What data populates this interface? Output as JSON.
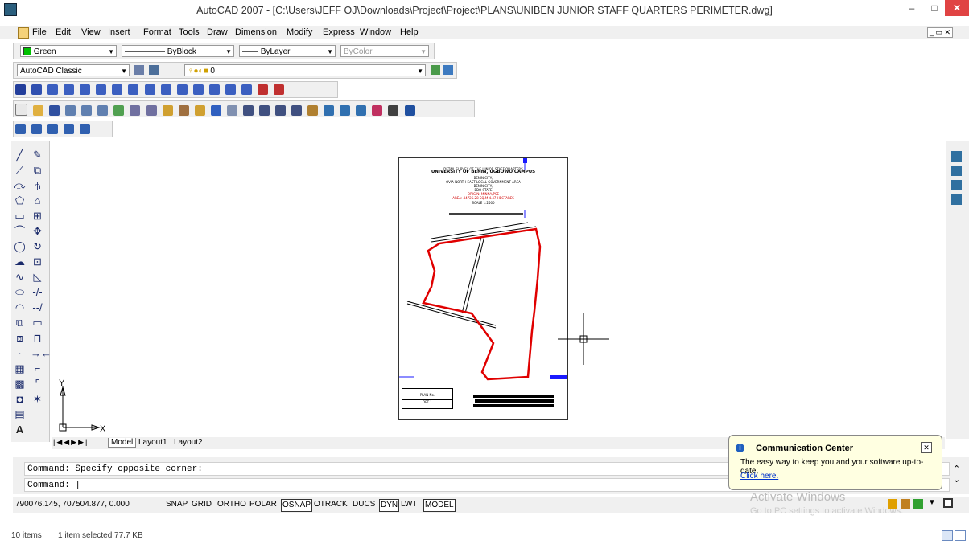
{
  "window": {
    "title": "AutoCAD 2007 - [C:\\Users\\JEFF OJ\\Downloads\\Project\\Project\\PLANS\\UNIBEN JUNIOR STAFF QUARTERS  PERIMETER.dwg]",
    "min_glyph": "–",
    "max_glyph": "□",
    "close_glyph": "✕"
  },
  "menu": [
    "File",
    "Edit",
    "View",
    "Insert",
    "Format",
    "Tools",
    "Draw",
    "Dimension",
    "Modify",
    "Express",
    "Window",
    "Help"
  ],
  "layer_toolbar": {
    "color": "Green",
    "color_hex": "#00c000",
    "linetype": "ByBlock",
    "lineweight": "ByLayer",
    "plotstyle": "ByColor"
  },
  "workspace": {
    "name": "AutoCAD Classic",
    "layer": "0"
  },
  "sheet": {
    "line1": "DETAIL SURVEY OF THE JUNIOR STAFF QUARTERS",
    "line2": "UNIVERSITY OF BENIN, UGBOWO CAMPUS",
    "line3": "BENIN CITY,",
    "line4": "OVIA NORTH EAST LOCAL GOVERNMENT AREA",
    "line5": "BENIN CITY,",
    "line6": "EDO STATE",
    "line7": "ORIGIN: MINNA/PSE",
    "line8": "AREA: 44725.28 SQ.M 4.47 HECTARES",
    "line9": "SCALE 1:2500",
    "plan_no_label": "PLAN No.",
    "plan_no_value": "DET 1"
  },
  "ucs": {
    "x": "X",
    "y": "Y"
  },
  "tabs": [
    "Model",
    "Layout1",
    "Layout2"
  ],
  "command": {
    "history": "Command: Specify opposite corner:",
    "prompt": "Command:"
  },
  "status": {
    "coords": "790076.145, 707504.877, 0.000",
    "buttons": [
      "SNAP",
      "GRID",
      "ORTHO",
      "POLAR",
      "OSNAP",
      "OTRACK",
      "DUCS",
      "DYN",
      "LWT",
      "MODEL"
    ]
  },
  "communication_center": {
    "title": "Communication Center",
    "message": "The easy way to keep you and your software up-to-date.",
    "link": "Click here."
  },
  "watermark": {
    "line1": "Activate Windows",
    "line2": "Go to PC settings to activate Windows."
  },
  "explorer": {
    "items": "10 items",
    "selected": "1 item selected  77.7 KB"
  }
}
